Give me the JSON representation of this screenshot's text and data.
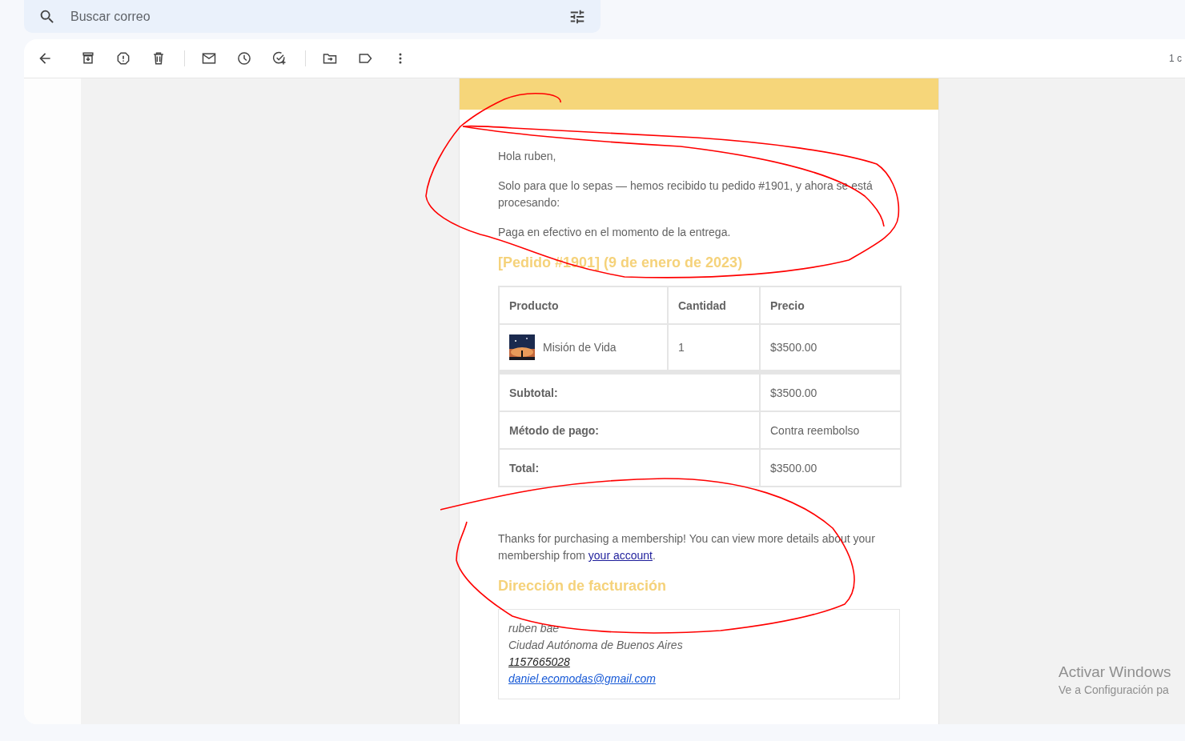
{
  "search": {
    "placeholder": "Buscar correo"
  },
  "toolbar": {
    "counter": "1 c"
  },
  "email": {
    "greeting": "Hola ruben,",
    "intro": "Solo para que lo sepas — hemos recibido tu pedido #1901, y ahora se está procesando:",
    "payment_note": "Paga en efectivo en el momento de la entrega.",
    "order_heading": "[Pedido #1901] (9 de enero de 2023)",
    "table": {
      "columns": [
        "Producto",
        "Cantidad",
        "Precio"
      ],
      "rows": [
        {
          "product": "Misión de Vida",
          "quantity": "1",
          "price": "$3500.00"
        }
      ],
      "totals": [
        {
          "label": "Subtotal:",
          "value": "$3500.00"
        },
        {
          "label": "Método de pago:",
          "value": "Contra reembolso"
        },
        {
          "label": "Total:",
          "value": "$3500.00"
        }
      ]
    },
    "membership": {
      "before": "Thanks for purchasing a membership! You can view more details about your membership from ",
      "link": "your account",
      "after": "."
    },
    "billing_heading": "Dirección de facturación",
    "address": [
      {
        "kind": "text",
        "text": "ruben bae"
      },
      {
        "kind": "text",
        "text": "Ciudad Autónoma de Buenos Aires"
      },
      {
        "kind": "phone",
        "text": "1157665028"
      },
      {
        "kind": "email",
        "text": "daniel.ecomodas@gmail.com"
      }
    ]
  },
  "os_notice": {
    "title": "Activar Windows",
    "subtitle": "Ve a Configuración pa"
  }
}
